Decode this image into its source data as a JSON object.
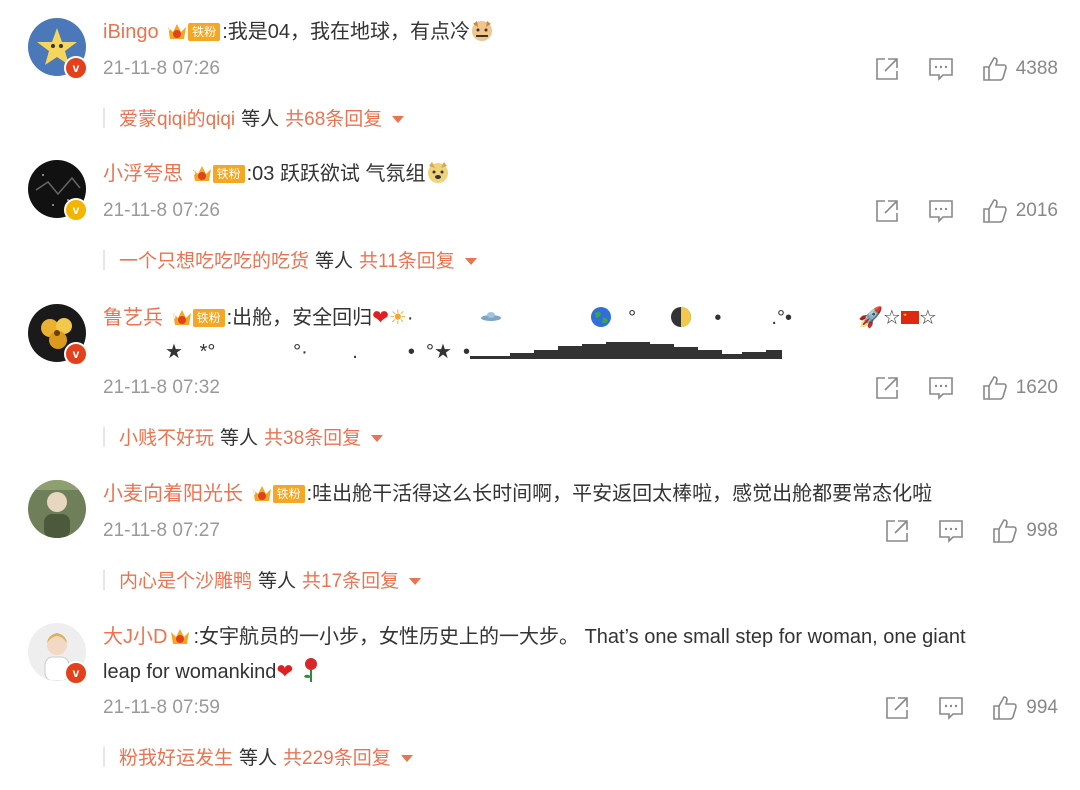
{
  "fan_badge_label": "铁粉",
  "comments": [
    {
      "username": "iBingo",
      "fan_level": "7",
      "text": ":我是04，我在地球，有点冷",
      "time": "21-11-8 07:26",
      "likes": "4388",
      "reply_user": "爱蒙qiqi的qiqi",
      "reply_mid": "等人",
      "reply_count": "共68条回复",
      "verified_color": "#e3411c"
    },
    {
      "username": "小浮夸思",
      "fan_level": "6",
      "text": ":03 跃跃欲试 气氛组",
      "time": "21-11-8 07:26",
      "likes": "2016",
      "reply_user": "一个只想吃吃吃的吃货",
      "reply_mid": "等人",
      "reply_count": "共11条回复",
      "verified_color": "#f4b400"
    },
    {
      "username": "鲁艺兵",
      "fan_level": "5",
      "text": ":出舱，安全回归",
      "text_line2_symbols": "★   *°              °·        .         •  °★  •",
      "time": "21-11-8 07:32",
      "likes": "1620",
      "reply_user": "小贱不好玩",
      "reply_mid": "等人",
      "reply_count": "共38条回复",
      "verified_color": "#e3411c"
    },
    {
      "username": "小麦向着阳光长",
      "fan_level": "5",
      "text": ":哇出舱干活得这么长时间啊，平安返回太棒啦，感觉出舱都要常态化啦",
      "time": "21-11-8 07:27",
      "likes": "998",
      "reply_user": "内心是个沙雕鸭",
      "reply_mid": "等人",
      "reply_count": "共17条回复",
      "verified_color": ""
    },
    {
      "username": "大J小D",
      "fan_level": "",
      "text": ":女宇航员的一小步，女性历史上的一大步。 That’s one small step for woman, one giant",
      "text_line2": "leap for womankind",
      "time": "21-11-8 07:59",
      "likes": "994",
      "reply_user": "粉我好运发生",
      "reply_mid": "等人",
      "reply_count": "共229条回复",
      "verified_color": "#e3411c"
    }
  ]
}
